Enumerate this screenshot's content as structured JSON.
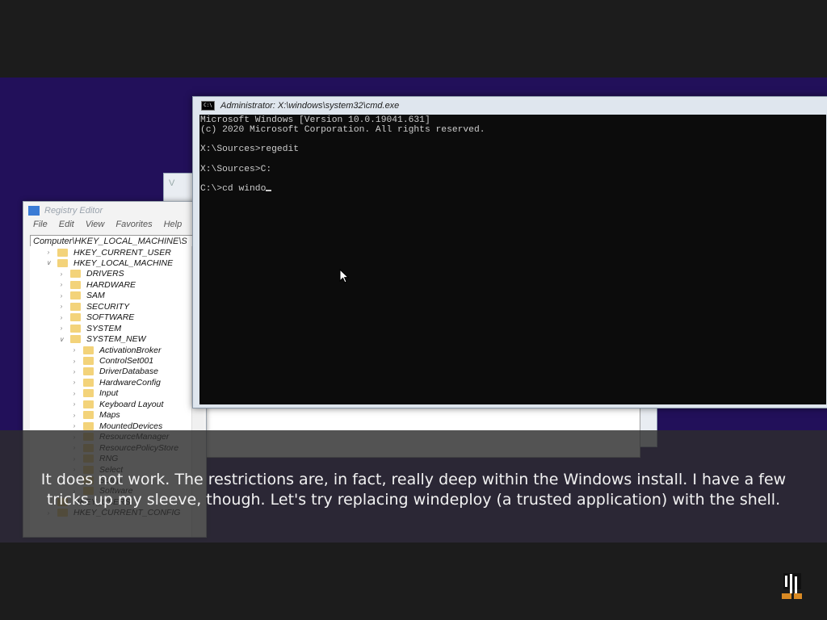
{
  "registry": {
    "title": "Registry Editor",
    "menu": [
      "File",
      "Edit",
      "View",
      "Favorites",
      "Help"
    ],
    "address": "Computer\\HKEY_LOCAL_MACHINE\\S",
    "tree": [
      {
        "label": "HKEY_CURRENT_USER",
        "level": 0,
        "expanded": false
      },
      {
        "label": "HKEY_LOCAL_MACHINE",
        "level": 0,
        "expanded": true
      },
      {
        "label": "DRIVERS",
        "level": 1,
        "expanded": false
      },
      {
        "label": "HARDWARE",
        "level": 1,
        "expanded": false
      },
      {
        "label": "SAM",
        "level": 1,
        "expanded": false
      },
      {
        "label": "SECURITY",
        "level": 1,
        "expanded": false
      },
      {
        "label": "SOFTWARE",
        "level": 1,
        "expanded": false
      },
      {
        "label": "SYSTEM",
        "level": 1,
        "expanded": false
      },
      {
        "label": "SYSTEM_NEW",
        "level": 1,
        "expanded": true
      },
      {
        "label": "ActivationBroker",
        "level": 2,
        "expanded": false
      },
      {
        "label": "ControlSet001",
        "level": 2,
        "expanded": false
      },
      {
        "label": "DriverDatabase",
        "level": 2,
        "expanded": false
      },
      {
        "label": "HardwareConfig",
        "level": 2,
        "expanded": false
      },
      {
        "label": "Input",
        "level": 2,
        "expanded": false
      },
      {
        "label": "Keyboard Layout",
        "level": 2,
        "expanded": false
      },
      {
        "label": "Maps",
        "level": 2,
        "expanded": false
      },
      {
        "label": "MountedDevices",
        "level": 2,
        "expanded": false
      },
      {
        "label": "ResourceManager",
        "level": 2,
        "expanded": false
      },
      {
        "label": "ResourcePolicyStore",
        "level": 2,
        "expanded": false
      },
      {
        "label": "RNG",
        "level": 2,
        "expanded": false
      },
      {
        "label": "Select",
        "level": 2,
        "expanded": false
      },
      {
        "label": "Setup",
        "level": 2,
        "expanded": false
      },
      {
        "label": "Software",
        "level": 2,
        "expanded": false
      },
      {
        "label": "HKEY_USERS",
        "level": 0,
        "expanded": false
      },
      {
        "label": "HKEY_CURRENT_CONFIG",
        "level": 0,
        "expanded": false
      }
    ]
  },
  "cmd": {
    "title": "Administrator: X:\\windows\\system32\\cmd.exe",
    "icon_text": "C:\\",
    "lines": [
      "Microsoft Windows [Version 10.0.19041.631]",
      "(c) 2020 Microsoft Corporation. All rights reserved.",
      "",
      "X:\\Sources>regedit",
      "",
      "X:\\Sources>C:",
      "",
      "C:\\>cd windo"
    ]
  },
  "subtitle": {
    "line1": "It does not work. The restrictions are, in fact, really deep within the Windows install. I have a few",
    "line2": "tricks up my sleeve, though. Let's try replacing windeploy (a trusted application) with the shell."
  },
  "colors": {
    "desktop": "#22105a",
    "console_bg": "#0c0c0c",
    "console_text": "#cccccc",
    "folder": "#f3d37a"
  },
  "icons": [
    "registry-editor-icon",
    "cmd-icon",
    "folder-icon",
    "chevron-icon",
    "mouse-pointer-icon",
    "channel-logo-icon"
  ]
}
